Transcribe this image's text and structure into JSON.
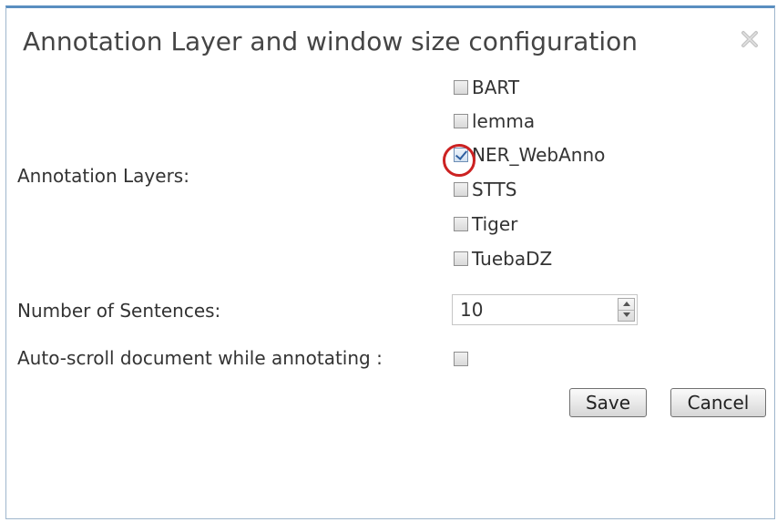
{
  "dialog": {
    "title": "Annotation Layer and window size configuration",
    "close_icon": "close-icon"
  },
  "form": {
    "annotation_layers_label": "Annotation Layers:",
    "layers": [
      {
        "label": "BART",
        "checked": false
      },
      {
        "label": "lemma",
        "checked": false
      },
      {
        "label": "NER_WebAnno",
        "checked": true
      },
      {
        "label": "STTS",
        "checked": false
      },
      {
        "label": "Tiger",
        "checked": false
      },
      {
        "label": "TuebaDZ",
        "checked": false
      }
    ],
    "sentences_label": "Number of Sentences:",
    "sentences_value": "10",
    "autoscroll_label": "Auto-scroll document while annotating :",
    "autoscroll_checked": false
  },
  "buttons": {
    "save_label": "Save",
    "cancel_label": "Cancel"
  },
  "colors": {
    "highlight_circle": "#cc2222",
    "title_border": "#5a8fc0"
  }
}
